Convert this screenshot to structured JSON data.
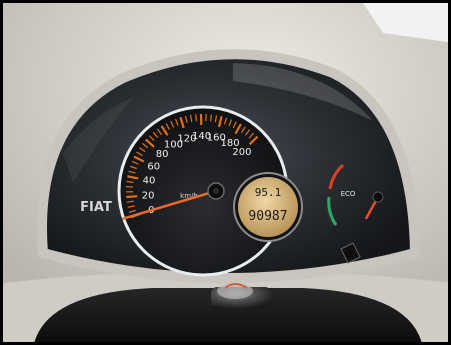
{
  "brand": "FIAT",
  "speedometer": {
    "unit": "km/h",
    "ticks": [
      "0",
      "20",
      "40",
      "60",
      "80",
      "100",
      "120",
      "140",
      "160",
      "180",
      "200"
    ],
    "max": 200,
    "needle_value": 8,
    "accent_color": "#e0701c"
  },
  "odometer": {
    "trip": "95.1",
    "total": "90987"
  },
  "eco_gauge": {
    "label": "ECO",
    "needle_fraction": 0.15
  },
  "colors": {
    "dash_gray": "#d7d4ce",
    "cluster_black": "#15171a",
    "scale_orange": "#e0701c",
    "chrome_ring": "#e6ecf0",
    "lcd_amber": "#d9b982",
    "eco_red": "#d8402a",
    "eco_green": "#2ea86a"
  }
}
